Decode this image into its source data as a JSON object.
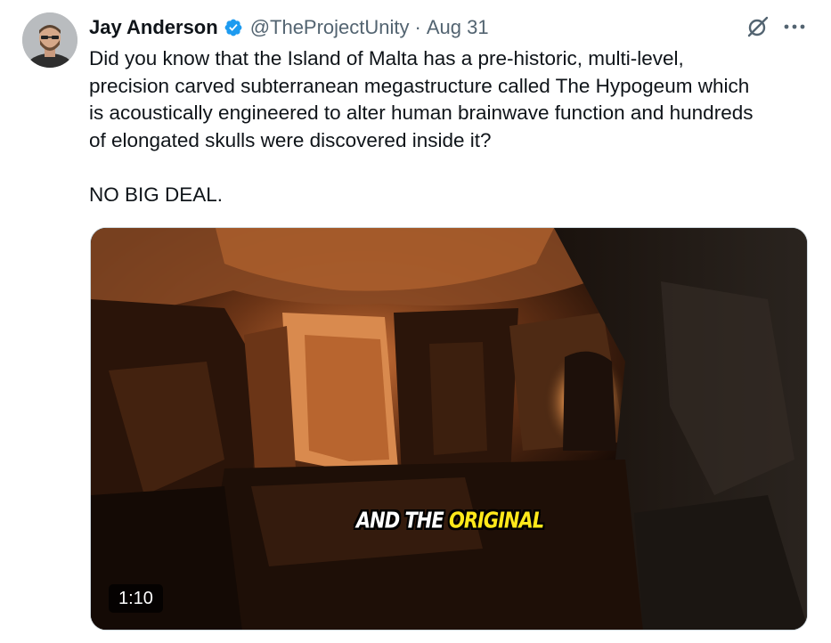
{
  "tweet": {
    "author": {
      "display_name": "Jay Anderson",
      "handle": "@TheProjectUnity",
      "verified_icon": "verified-badge-icon"
    },
    "date_separator": "·",
    "date": "Aug 31",
    "text_lines": [
      "Did you know that the Island of Malta has a pre-historic, multi-level,",
      "precision carved subterranean megastructure called The Hypogeum which",
      "is acoustically engineered to alter human brainwave function and hundreds",
      "of elongated skulls were discovered inside it?"
    ],
    "text_tail": "NO BIG DEAL.",
    "media": {
      "caption_white": "AND THE",
      "caption_yellow": "ORIGINAL",
      "duration": "1:10"
    },
    "icons": [
      "grok-icon",
      "more-icon"
    ],
    "colors": {
      "text": "#0f1419",
      "secondary": "#536471",
      "verified": "#1d9bf0",
      "caption_highlight": "#ffe81a"
    }
  }
}
